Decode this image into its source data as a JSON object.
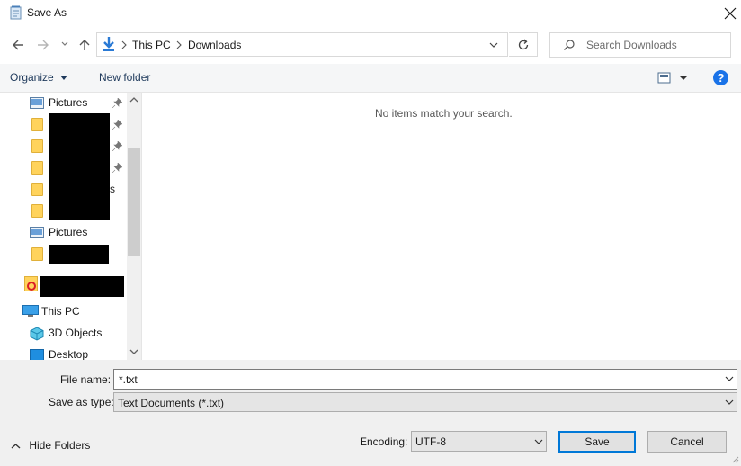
{
  "window": {
    "title": "Save As"
  },
  "address_bar": {
    "breadcrumbs": [
      "This PC",
      "Downloads"
    ]
  },
  "search": {
    "placeholder": "Search Downloads"
  },
  "toolbar": {
    "organize_label": "Organize",
    "new_folder_label": "New folder"
  },
  "nav_pane": {
    "items": [
      {
        "label": "Pictures",
        "icon": "pictures-icon",
        "pinned": true
      },
      {
        "label": "",
        "icon": "folder-icon",
        "pinned": true,
        "redacted": true
      },
      {
        "label": "",
        "icon": "folder-icon",
        "pinned": true,
        "redacted": true
      },
      {
        "label": "",
        "icon": "folder-icon",
        "pinned": true,
        "redacted": true
      },
      {
        "label": "s",
        "icon": "folder-icon",
        "pinned": false,
        "redacted": true
      },
      {
        "label": "",
        "icon": "folder-icon",
        "pinned": false,
        "redacted": true
      },
      {
        "label": "Pictures",
        "icon": "pictures-icon",
        "pinned": false
      },
      {
        "label": "",
        "icon": "folder-icon",
        "pinned": false,
        "redacted": true
      },
      {
        "label": "",
        "icon": "creative-cloud-icon",
        "pinned": false,
        "redacted": true
      },
      {
        "label": "This PC",
        "icon": "this-pc-icon",
        "pinned": false
      },
      {
        "label": "3D Objects",
        "icon": "3d-objects-icon",
        "pinned": false
      },
      {
        "label": "Desktop",
        "icon": "desktop-icon",
        "pinned": false
      }
    ]
  },
  "content": {
    "empty_message": "No items match your search."
  },
  "form": {
    "file_name_label": "File name:",
    "file_name_value": "*.txt",
    "save_as_type_label": "Save as type:",
    "save_as_type_value": "Text Documents (*.txt)",
    "encoding_label": "Encoding:",
    "encoding_value": "UTF-8"
  },
  "footer": {
    "hide_folders_label": "Hide Folders",
    "save_label": "Save",
    "cancel_label": "Cancel"
  },
  "colors": {
    "accent": "#0078d7",
    "help_icon": "#1a73e8",
    "toolbar_bg": "#f5f6f7",
    "form_bg": "#f0f0f0"
  }
}
